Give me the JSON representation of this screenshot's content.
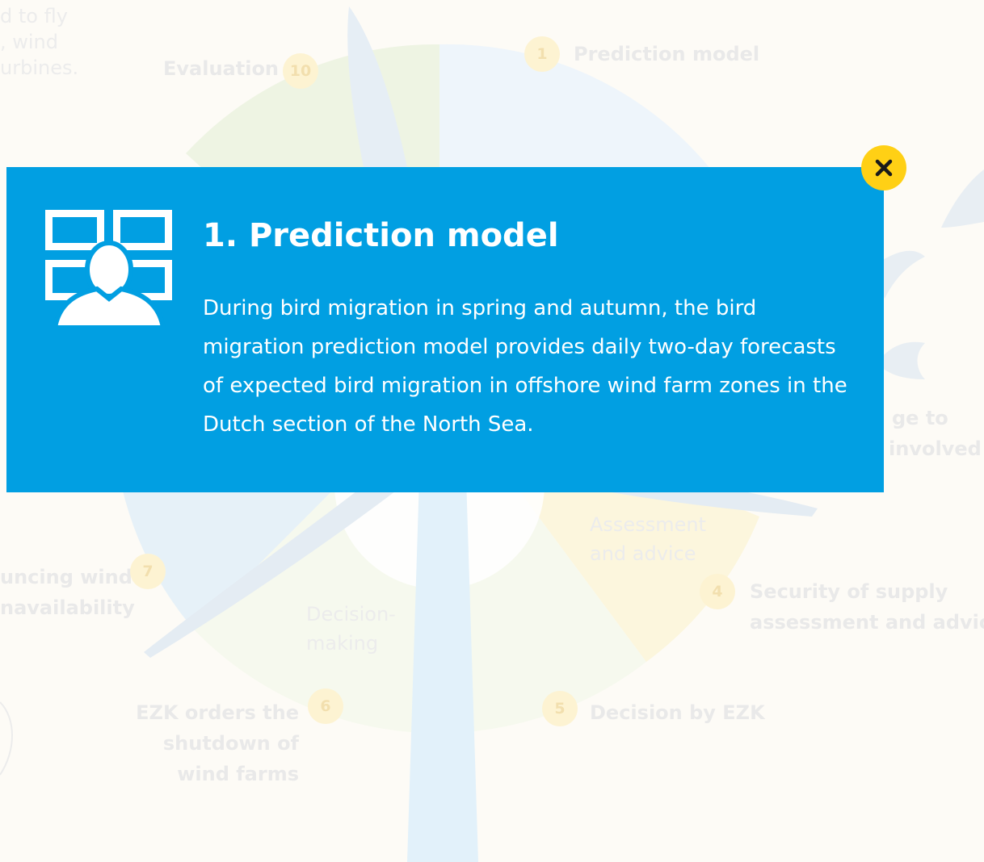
{
  "background": {
    "steps": [
      {
        "number": "1",
        "label": "Prediction model"
      },
      {
        "number": "10",
        "label": "Evaluation"
      },
      {
        "number": "7",
        "label_line1": "uncing wind",
        "label_line2": "navailability"
      },
      {
        "number": "6",
        "label_line1": "EZK orders the",
        "label_line2": "shutdown of",
        "label_line3": "wind farms"
      },
      {
        "number": "5",
        "label": "Decision by EZK"
      },
      {
        "number": "4",
        "label_line1": "Security of supply",
        "label_line2": "assessment and advice"
      }
    ],
    "partial_right_line1": "ge to",
    "partial_right_line2": "involved",
    "corner_text": [
      "d to fly",
      ", wind",
      "urbines."
    ],
    "phases": {
      "assessment_line1": "Assessment",
      "assessment_line2": "and advice",
      "decision_line1": "Decision-",
      "decision_line2": "making"
    }
  },
  "modal": {
    "icon": "monitoring-screens-person-icon",
    "title": "1. Prediction model",
    "body": "During bird migration in spring and autumn, the bird migration prediction model provides daily two-day forecasts of expected bird migration in offshore wind farm zones in the Dutch section of the North Sea.",
    "close_icon": "close-icon"
  },
  "colors": {
    "modal_background": "#019fe2",
    "close_button": "#ffd015",
    "badge": "#fdf3d2"
  }
}
